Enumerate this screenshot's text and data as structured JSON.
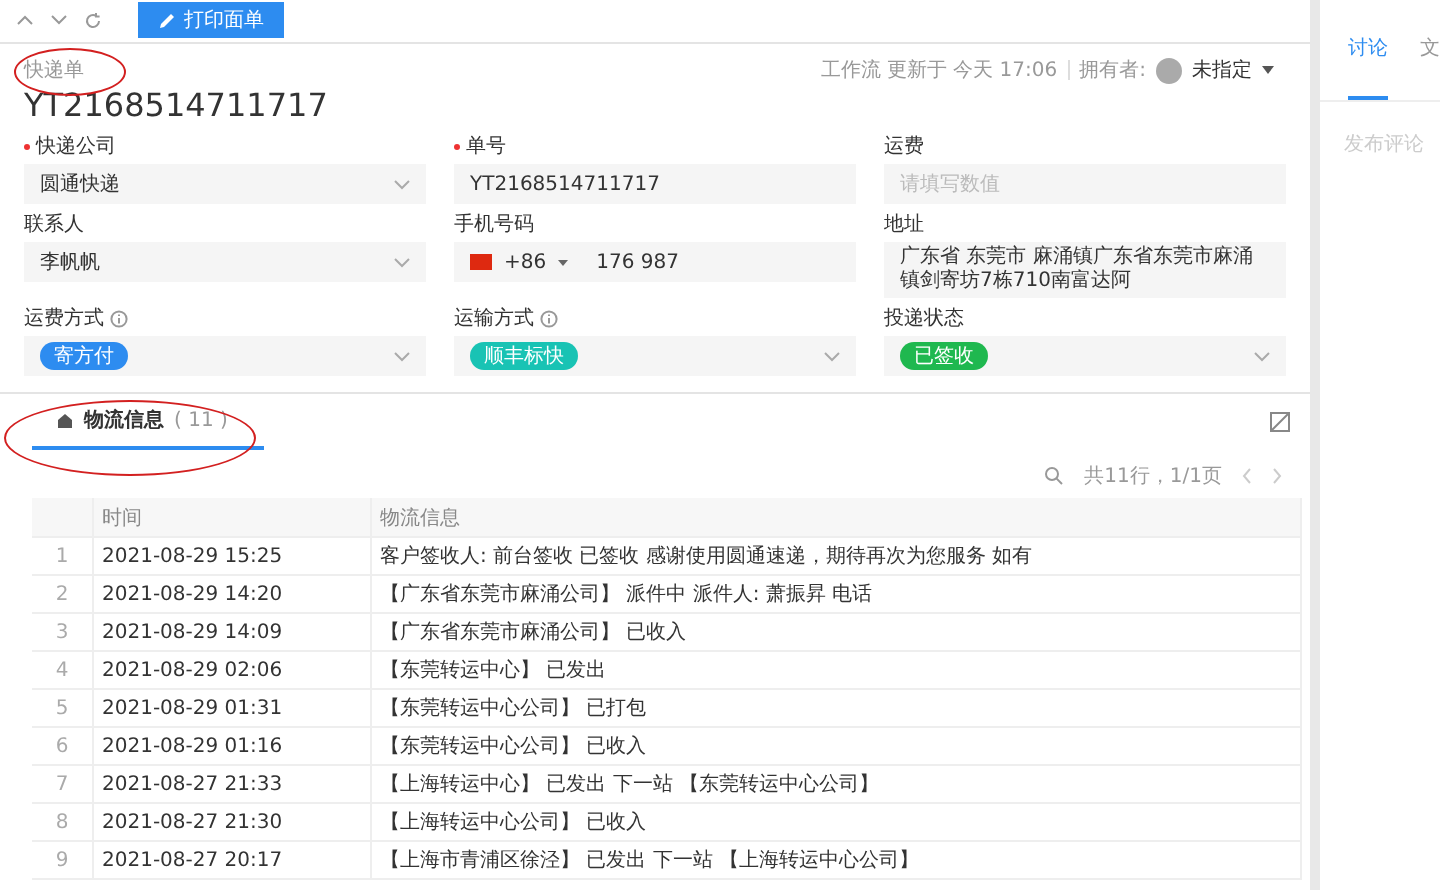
{
  "toolbar": {
    "print_button": "打印面单"
  },
  "record": {
    "type_label": "快递单",
    "title": "YT2168514711717",
    "updated": "工作流 更新于 今天 17:06",
    "owner_label": "拥有者:",
    "owner": "未指定"
  },
  "fields": [
    {
      "label": "快递公司",
      "required": true,
      "kind": "select",
      "value": "圆通快递"
    },
    {
      "label": "单号",
      "required": true,
      "kind": "text",
      "value": "YT2168514711717"
    },
    {
      "label": "运费",
      "required": false,
      "kind": "text",
      "placeholder": "请填写数值"
    },
    {
      "label": "联系人",
      "required": false,
      "kind": "select",
      "value": "李帆帆"
    },
    {
      "label": "手机号码",
      "required": false,
      "kind": "phone",
      "code": "+86",
      "value": "176 987"
    },
    {
      "label": "地址",
      "required": false,
      "kind": "text",
      "value": "广东省 东莞市 麻涌镇广东省东莞市麻涌镇剑寄坊7栋710南富达阿"
    },
    {
      "label": "运费方式",
      "required": false,
      "info": true,
      "kind": "tag",
      "value": "寄方付",
      "color": "#2d8cf0"
    },
    {
      "label": "运输方式",
      "required": false,
      "info": true,
      "kind": "tag",
      "value": "顺丰标快",
      "color": "#19c3b4"
    },
    {
      "label": "投递状态",
      "required": false,
      "kind": "tag",
      "value": "已签收",
      "color": "#1fb84f"
    }
  ],
  "tabs": [
    {
      "label": "物流信息",
      "count": "( 11 )",
      "selected": true
    }
  ],
  "pager": {
    "summary": "共11行，1/1页"
  },
  "table": {
    "columns": [
      "时间",
      "物流信息"
    ],
    "rows": [
      {
        "index": "1",
        "time": "2021-08-29 15:25",
        "info": "客户签收人: 前台签收 已签收 感谢使用圆通速递，期待再次为您服务 如有"
      },
      {
        "index": "2",
        "time": "2021-08-29 14:20",
        "info": "【广东省东莞市麻涌公司】 派件中 派件人: 萧振昇 电话"
      },
      {
        "index": "3",
        "time": "2021-08-29 14:09",
        "info": "【广东省东莞市麻涌公司】 已收入"
      },
      {
        "index": "4",
        "time": "2021-08-29 02:06",
        "info": "【东莞转运中心】 已发出"
      },
      {
        "index": "5",
        "time": "2021-08-29 01:31",
        "info": "【东莞转运中心公司】 已打包"
      },
      {
        "index": "6",
        "time": "2021-08-29 01:16",
        "info": "【东莞转运中心公司】 已收入"
      },
      {
        "index": "7",
        "time": "2021-08-27 21:33",
        "info": "【上海转运中心】 已发出 下一站 【东莞转运中心公司】"
      },
      {
        "index": "8",
        "time": "2021-08-27 21:30",
        "info": "【上海转运中心公司】 已收入"
      },
      {
        "index": "9",
        "time": "2021-08-27 20:17",
        "info": "【上海市青浦区徐泾】 已发出 下一站 【上海转运中心公司】"
      }
    ]
  },
  "side_panel": {
    "tabs": [
      {
        "label": "讨论",
        "selected": true
      },
      {
        "label": "文",
        "selected": false
      }
    ],
    "comment_placeholder": "发布评论"
  }
}
